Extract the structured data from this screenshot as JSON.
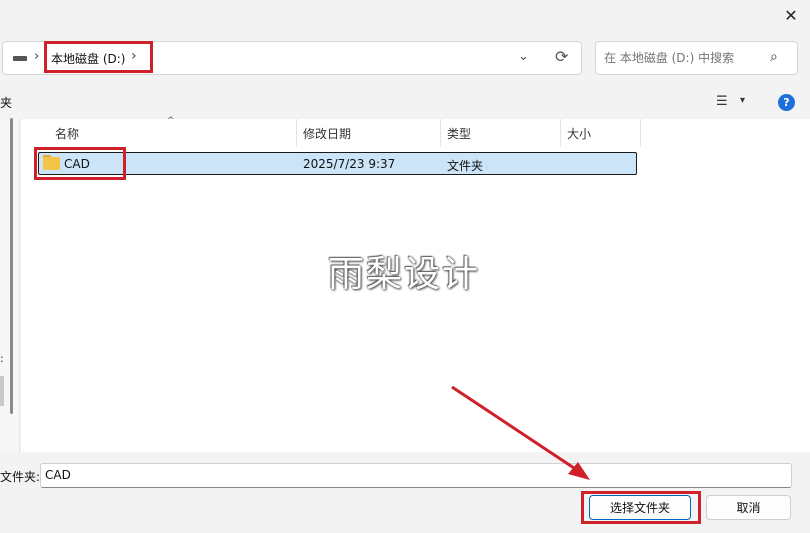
{
  "window": {
    "close_glyph": "✕"
  },
  "address_bar": {
    "crumb_arrow": "›",
    "current_location": "本地磁盘 (D:)",
    "trailing_arrow": "›",
    "history_glyph": "⌄",
    "refresh_glyph": "⟳",
    "icons": [
      "drive-icon",
      "chevron-down-icon",
      "refresh-icon"
    ]
  },
  "search": {
    "placeholder": "在 本地磁盘 (D:) 中搜索",
    "icon_glyph": "⌕"
  },
  "toolbar": {
    "new_folder_fragment": "夹",
    "view_glyph": "☰",
    "view_dd_glyph": "▾",
    "help_glyph": "?"
  },
  "nav_pane": {
    "label_fragment": ":"
  },
  "file_list": {
    "columns": [
      "名称",
      "修改日期",
      "类型",
      "大小"
    ],
    "sort_glyph": "^",
    "rows": [
      {
        "name": "CAD",
        "modified": "2025/7/23 9:37",
        "type": "文件夹",
        "size": ""
      }
    ]
  },
  "watermark": {
    "text": "雨梨设计"
  },
  "footer": {
    "folder_label": "文件夹:",
    "folder_value": "CAD",
    "select_button": "选择文件夹",
    "cancel_button": "取消"
  },
  "colors": {
    "annotation_red": "#d0202a",
    "selection_bg": "#cce4f7",
    "folder_yellow": "#f2c447",
    "accent_blue": "#0067c0"
  }
}
